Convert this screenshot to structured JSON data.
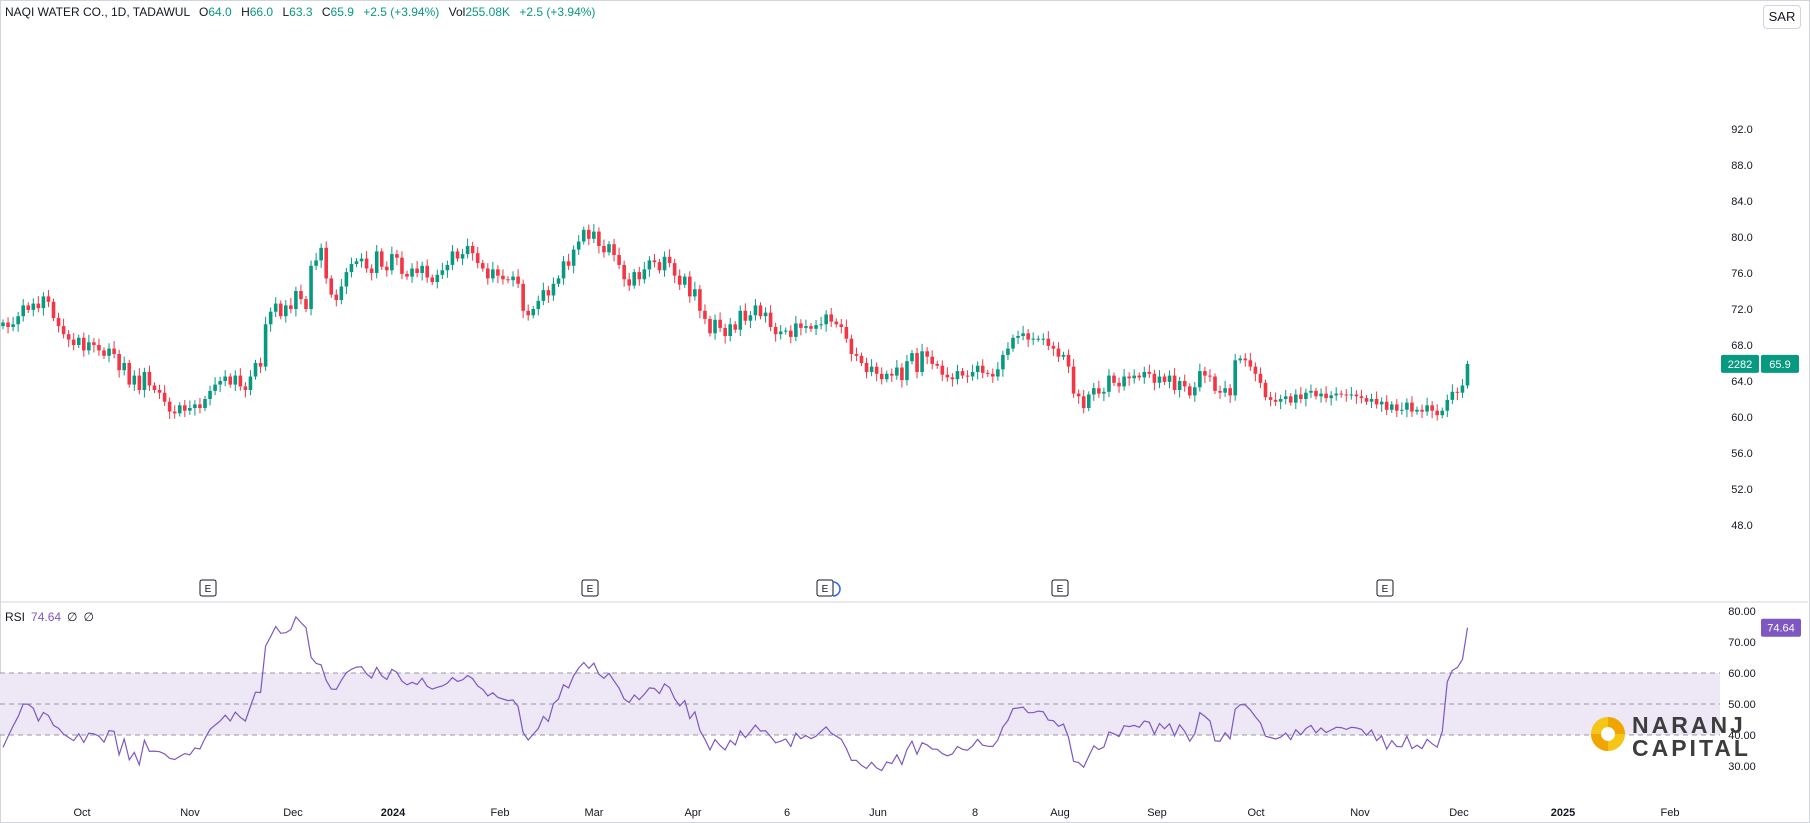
{
  "header": {
    "symbol": "NAQI WATER CO., 1D, TADAWUL",
    "o_label": "O",
    "o_value": "64.0",
    "h_label": "H",
    "h_value": "66.0",
    "l_label": "L",
    "l_value": "63.3",
    "c_label": "C",
    "c_value": "65.9",
    "change": "+2.5 (+3.94%)",
    "vol_label": "Vol",
    "vol_value": "255.08K",
    "vol_change": "+2.5 (+3.94%)"
  },
  "currency": "SAR",
  "rsi_header": {
    "label": "RSI",
    "value": "74.64",
    "ph1": "∅",
    "ph2": "∅"
  },
  "price_tag": {
    "countdown": "2282",
    "price": "65.9"
  },
  "rsi_tag": "74.64",
  "earnings_marker": "E",
  "logo": {
    "line1": "NARANJ",
    "line2": "CAPITAL"
  },
  "colors": {
    "up": "#089981",
    "down": "#f23645",
    "rsi": "#7e57c2",
    "band": "#ede7f6",
    "grid": "#e0e3eb"
  },
  "chart_data": [
    {
      "type": "candlestick",
      "title": "NAQI WATER CO., 1D, TADAWUL",
      "y_ticks": [
        "92.0",
        "88.0",
        "84.0",
        "80.0",
        "76.0",
        "72.0",
        "68.0",
        "64.0",
        "60.0",
        "56.0",
        "52.0",
        "48.0"
      ],
      "ylim": [
        45,
        96
      ],
      "x_ticks": [
        "Oct",
        "Nov",
        "Dec",
        "2024",
        "Feb",
        "Mar",
        "Apr",
        "6",
        "Jun",
        "8",
        "Aug",
        "Sep",
        "Oct",
        "Nov",
        "Dec",
        "2025",
        "Feb"
      ],
      "bold_x_ticks": [
        "2024",
        "2025"
      ],
      "close": [
        70.5,
        70.0,
        70.3,
        71.2,
        72.4,
        71.9,
        72.6,
        72.1,
        73.4,
        72.8,
        71.0,
        70.1,
        69.2,
        68.6,
        68.0,
        68.8,
        67.4,
        68.3,
        68.0,
        67.4,
        66.8,
        67.6,
        67.0,
        65.2,
        66.0,
        63.6,
        64.6,
        63.0,
        65.0,
        63.5,
        63.0,
        62.7,
        61.7,
        60.6,
        60.4,
        61.3,
        60.7,
        61.0,
        61.4,
        61.0,
        62.0,
        62.9,
        63.6,
        64.0,
        64.5,
        63.6,
        64.6,
        63.4,
        63.0,
        64.5,
        66.0,
        65.6,
        70.3,
        71.7,
        72.6,
        71.2,
        72.4,
        72.0,
        74.0,
        73.1,
        72.0,
        76.8,
        77.4,
        78.8,
        75.4,
        73.6,
        73.0,
        74.5,
        76.1,
        77.0,
        77.3,
        77.6,
        76.5,
        76.0,
        78.4,
        76.7,
        76.3,
        78.1,
        77.7,
        75.9,
        75.6,
        76.5,
        76.0,
        76.8,
        75.5,
        75.0,
        75.8,
        76.3,
        76.9,
        78.4,
        77.6,
        78.1,
        79.0,
        78.2,
        77.1,
        76.5,
        75.4,
        76.4,
        75.7,
        75.3,
        75.2,
        75.6,
        74.8,
        71.8,
        71.3,
        72.0,
        72.9,
        74.1,
        73.5,
        74.8,
        75.4,
        77.3,
        76.8,
        78.6,
        79.5,
        80.8,
        79.8,
        80.6,
        79.0,
        78.3,
        79.2,
        78.0,
        76.9,
        75.3,
        74.6,
        76.1,
        75.3,
        76.4,
        77.4,
        77.2,
        76.3,
        77.8,
        77.1,
        75.7,
        74.7,
        75.6,
        73.4,
        74.2,
        71.8,
        70.9,
        69.3,
        70.8,
        69.9,
        69.0,
        70.3,
        69.7,
        71.8,
        70.7,
        71.3,
        72.4,
        71.2,
        71.6,
        70.0,
        69.2,
        69.5,
        69.6,
        68.9,
        70.4,
        69.9,
        70.1,
        69.8,
        70.2,
        70.3,
        71.4,
        70.6,
        70.3,
        70.0,
        68.7,
        67.0,
        66.8,
        66.0,
        65.0,
        65.6,
        64.8,
        64.2,
        64.8,
        64.6,
        65.5,
        64.1,
        66.2,
        67.1,
        65.0,
        67.3,
        66.7,
        65.9,
        65.7,
        64.7,
        64.4,
        64.2,
        65.1,
        64.6,
        64.5,
        65.0,
        65.7,
        64.9,
        64.8,
        64.5,
        65.3,
        66.9,
        67.6,
        68.8,
        69.0,
        69.3,
        68.6,
        68.7,
        68.7,
        68.7,
        67.9,
        67.6,
        66.7,
        66.9,
        65.6,
        62.6,
        62.3,
        61.0,
        62.5,
        63.2,
        62.6,
        62.8,
        64.6,
        63.8,
        63.4,
        64.5,
        64.3,
        64.6,
        64.4,
        65.0,
        64.8,
        63.8,
        64.5,
        63.9,
        64.6,
        63.0,
        64.0,
        63.4,
        62.4,
        63.3,
        65.1,
        64.6,
        64.5,
        62.9,
        62.7,
        63.2,
        62.4,
        66.3,
        66.5,
        66.3,
        65.6,
        64.8,
        63.8,
        62.2,
        61.9,
        61.7,
        62.0,
        62.3,
        61.6,
        62.5,
        62.0,
        62.7,
        62.9,
        62.3,
        62.6,
        62.1,
        62.4,
        62.6,
        62.5,
        62.4,
        62.5,
        62.3,
        62.1,
        61.7,
        62.0,
        61.4,
        61.7,
        60.8,
        61.4,
        60.7,
        60.8,
        61.6,
        60.6,
        60.8,
        60.6,
        61.3,
        60.7,
        60.2,
        60.7,
        61.9,
        62.8,
        62.7,
        63.5,
        65.9
      ]
    },
    {
      "type": "line",
      "title": "RSI",
      "series": [
        {
          "name": "RSI",
          "values": [
            36,
            39.6,
            42.9,
            45.9,
            50,
            49.9,
            48.6,
            44.5,
            47.3,
            46.3,
            43.1,
            42.2,
            40.3,
            39.2,
            38.2,
            40.4,
            37.6,
            40.6,
            40.4,
            39.6,
            37.7,
            41.4,
            41.2,
            33.6,
            38.7,
            32,
            34.4,
            30.4,
            38.3,
            34.7,
            34.8,
            34.6,
            33.9,
            32.5,
            32.1,
            33.1,
            34,
            33.6,
            35.8,
            35.5,
            38.9,
            41.8,
            43.2,
            44.5,
            46.4,
            44.5,
            47.4,
            45.7,
            44.5,
            49.2,
            53.8,
            53.7,
            68.7,
            71.7,
            75,
            72.8,
            73,
            74,
            78.1,
            76.3,
            74.6,
            65.1,
            63.1,
            62.6,
            57.6,
            54.8,
            54.7,
            57.6,
            60.1,
            61.2,
            61.9,
            62,
            59.7,
            58.4,
            61.8,
            59.1,
            57.9,
            61.2,
            60.2,
            57.4,
            56.2,
            57,
            56.3,
            58.3,
            55.7,
            54.8,
            55.4,
            55.8,
            56.7,
            58.5,
            57.3,
            57.8,
            59.2,
            58.2,
            55.8,
            54.7,
            52.6,
            53.6,
            52.1,
            51.6,
            51.1,
            51.3,
            49.2,
            40.8,
            38.4,
            40.3,
            42.1,
            46,
            44.4,
            50.1,
            51.6,
            56.2,
            55.2,
            59.1,
            61.6,
            63.4,
            61.5,
            63.2,
            59.6,
            58.3,
            59.9,
            57.5,
            55.1,
            51.6,
            50.5,
            52.9,
            51.4,
            53.2,
            55.2,
            55,
            53.4,
            56.5,
            55.3,
            51.7,
            49.4,
            51.1,
            45.3,
            47.5,
            41.5,
            38.6,
            35.2,
            38.5,
            36.6,
            35.2,
            38.3,
            36.8,
            41.3,
            39.2,
            41.1,
            43.2,
            41.3,
            41.4,
            39.5,
            37.5,
            38,
            38.7,
            36.3,
            40.6,
            38.8,
            39.8,
            38.8,
            39.6,
            41.2,
            42.6,
            40.6,
            39.6,
            38.6,
            35.6,
            31.8,
            31.8,
            30.2,
            29.2,
            31.2,
            29.4,
            28.5,
            31.3,
            30.8,
            33.6,
            30.5,
            35.3,
            38,
            33.8,
            37.5,
            36.8,
            35.5,
            35.4,
            34,
            33.3,
            33.9,
            36.3,
            35.4,
            35.1,
            36.5,
            38.6,
            36.7,
            36.4,
            36.3,
            38.4,
            42.6,
            44.7,
            48.5,
            48.7,
            49,
            47.2,
            47.2,
            47.7,
            47.5,
            44.8,
            44.6,
            42.8,
            43.5,
            39.3,
            31.5,
            31.1,
            29.6,
            33.2,
            36.5,
            35.3,
            36.1,
            41,
            40.4,
            39.5,
            43,
            42.7,
            43.1,
            42.5,
            44.5,
            44.1,
            40.3,
            43.7,
            42,
            43.6,
            39.7,
            43.3,
            41.2,
            38,
            40.4,
            47.2,
            46,
            44.5,
            38.1,
            38,
            40.7,
            38.8,
            48.3,
            49.8,
            49.7,
            48.1,
            45.9,
            43.9,
            39.6,
            39.2,
            38.7,
            39.3,
            40.6,
            38.5,
            41.7,
            40.1,
            42.1,
            43.1,
            40.7,
            42.3,
            40.8,
            41.6,
            42.5,
            42.4,
            41.8,
            42.5,
            42.3,
            41.8,
            39.9,
            41.6,
            38.2,
            39.7,
            35.5,
            38.2,
            36.3,
            36.2,
            39.6,
            35.6,
            36.7,
            35.6,
            38.6,
            37.2,
            36.1,
            41.2,
            57.2,
            60.8,
            61.8,
            64.4,
            74.6
          ]
        }
      ],
      "y_ticks": [
        "80.00",
        "70.00",
        "60.00",
        "50.00",
        "40.00",
        "30.00"
      ],
      "ylim": [
        22,
        85
      ],
      "levels": [
        70,
        50,
        30
      ],
      "band": [
        30,
        70
      ],
      "x_ticks": [
        "Oct",
        "Nov",
        "Dec",
        "2024",
        "Feb",
        "Mar",
        "Apr",
        "6",
        "Jun",
        "8",
        "Aug",
        "Sep",
        "Oct",
        "Nov",
        "Dec",
        "2025",
        "Feb"
      ],
      "grid": false
    }
  ]
}
